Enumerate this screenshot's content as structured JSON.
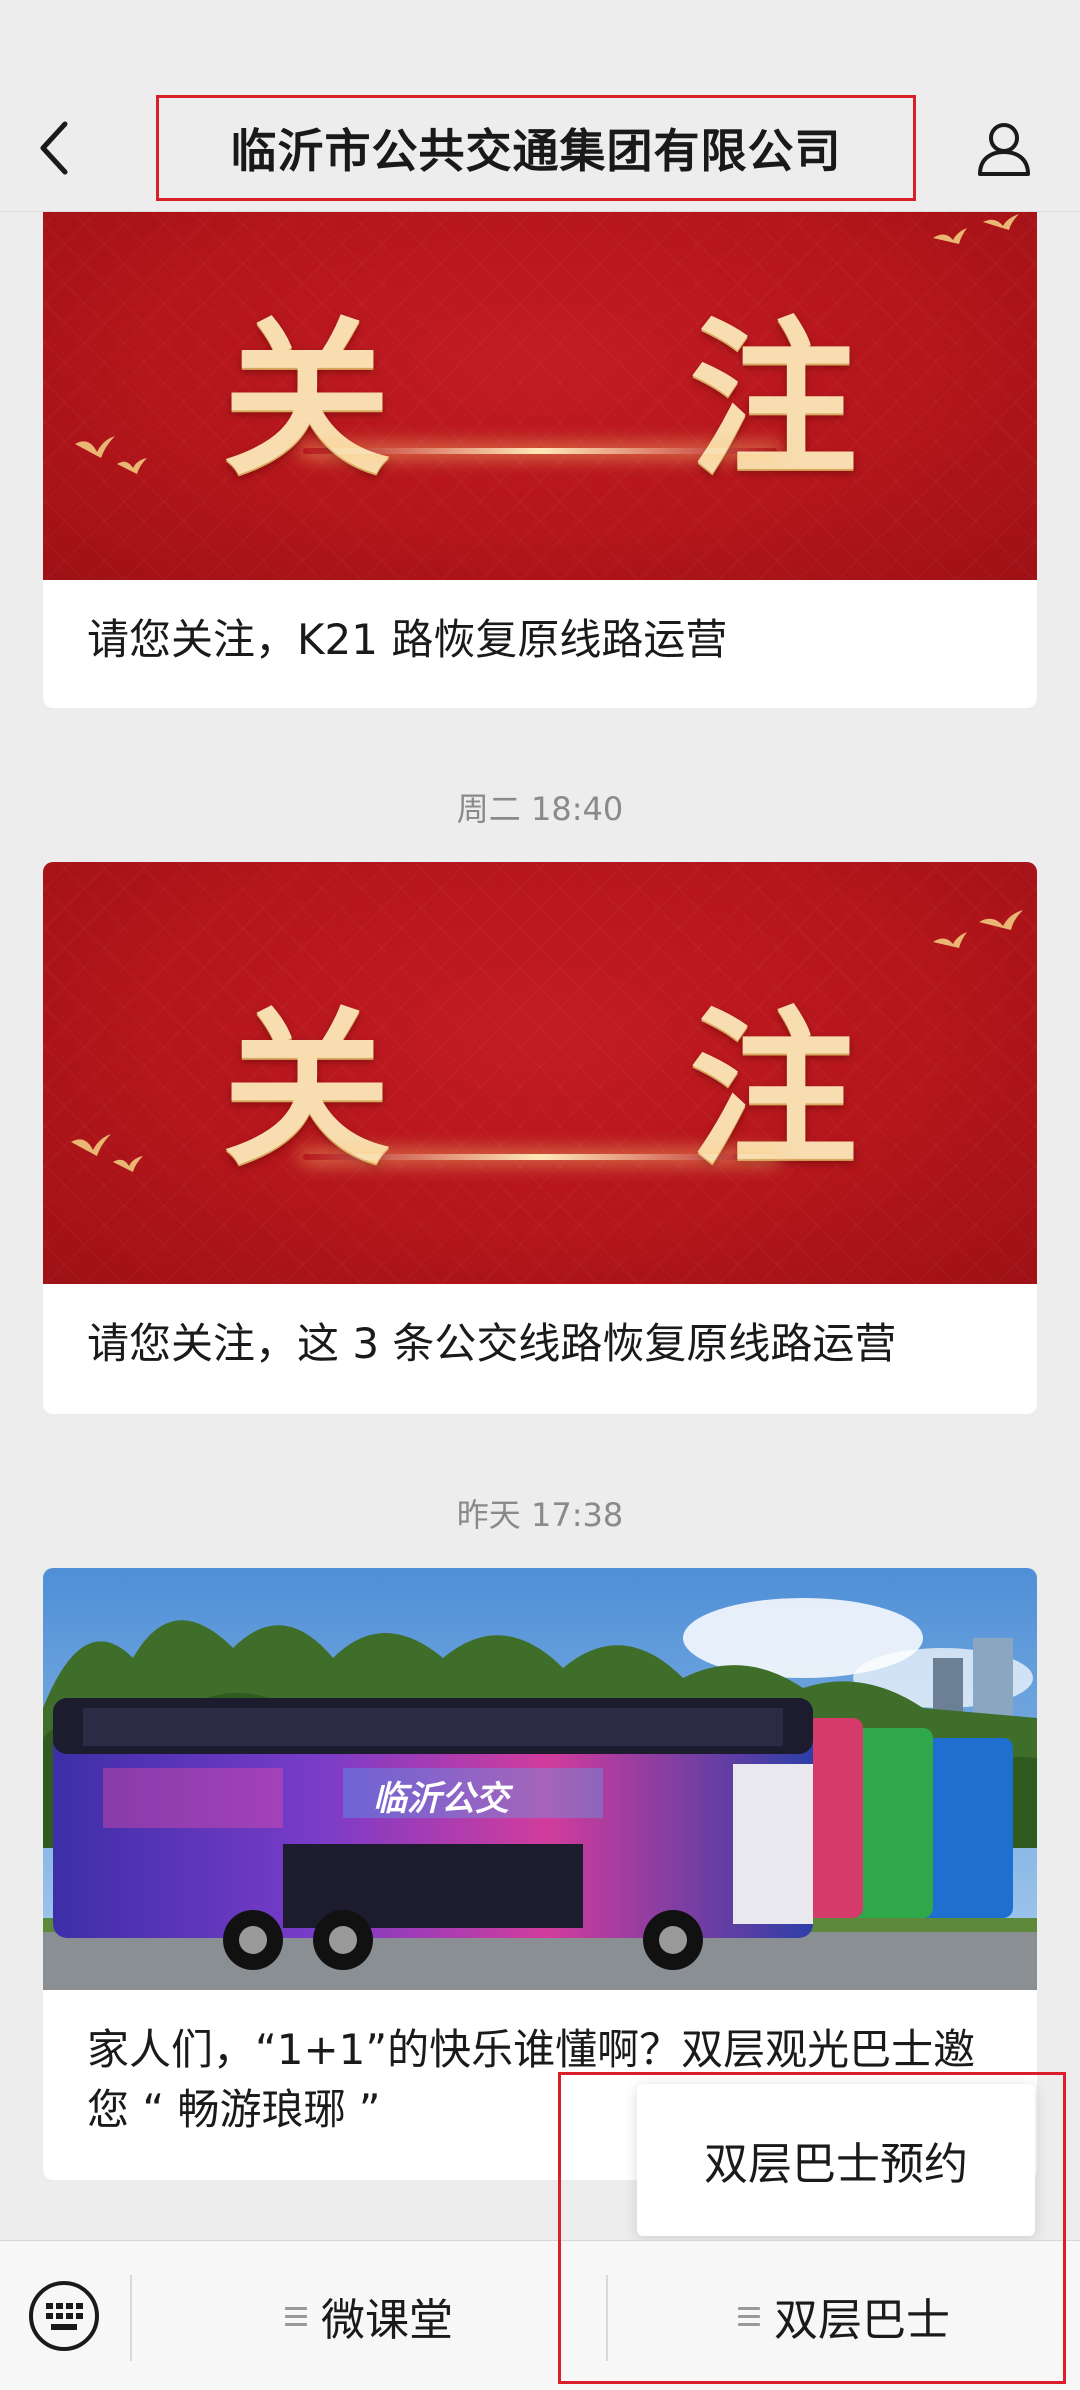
{
  "header": {
    "title": "临沂市公共交通集团有限公司",
    "back_icon": "chevron-left-icon",
    "profile_icon": "person-icon"
  },
  "articles": [
    {
      "cover_text": "关 注",
      "caption": "请您关注，K21 路恢复原线路运营"
    },
    {
      "timestamp": "周二 18:40",
      "cover_text": "关 注",
      "caption": "请您关注，这 3 条公交线路恢复原线路运营"
    },
    {
      "timestamp": "昨天 17:38",
      "cover_logo_text": "临沂公交",
      "caption": "家人们，“1+1”的快乐谁懂啊？双层观光巴士邀您 “ 畅游琅琊 ”"
    }
  ],
  "popup": {
    "label": "双层巴士预约"
  },
  "bottom_menu": {
    "keyboard_icon": "keyboard-icon",
    "items": [
      {
        "label": "微课堂"
      },
      {
        "label": "双层巴士"
      }
    ]
  },
  "colors": {
    "highlight": "#d9202a",
    "cover_red": "#b4161b",
    "cover_gold": "#f7ddb0",
    "background": "#ededed"
  }
}
